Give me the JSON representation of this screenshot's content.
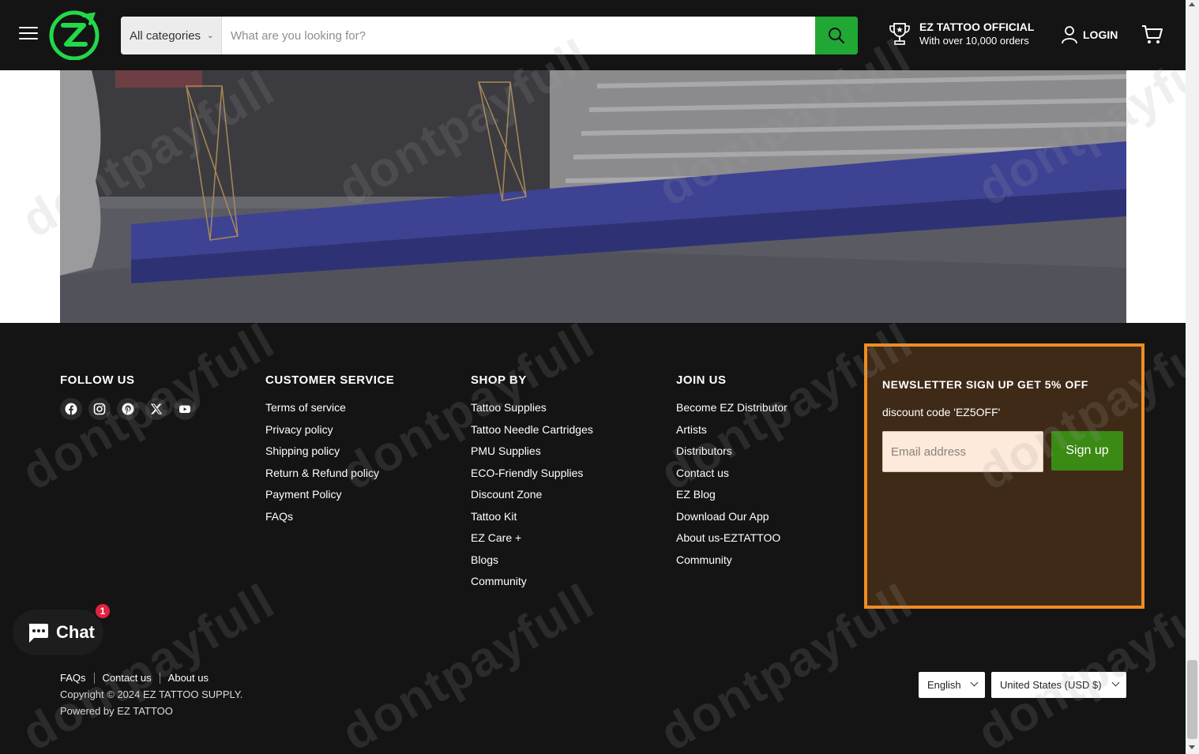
{
  "header": {
    "brand": "EZ",
    "search": {
      "category": "All categories",
      "placeholder": "What are you looking for?",
      "value": ""
    },
    "official": {
      "title": "EZ TATTOO OFFICIAL",
      "subtitle": "With over 10,000 orders"
    },
    "login_label": "LOGIN"
  },
  "footer": {
    "follow": {
      "title": "FOLLOW US",
      "icons": [
        "facebook-icon",
        "instagram-icon",
        "pinterest-icon",
        "x-icon",
        "youtube-icon"
      ]
    },
    "customer_service": {
      "title": "CUSTOMER SERVICE",
      "links": [
        "Terms of service",
        "Privacy policy",
        "Shipping policy",
        "Return & Refund policy",
        "Payment Policy",
        "FAQs"
      ]
    },
    "shop_by": {
      "title": "SHOP BY",
      "links": [
        "Tattoo Supplies",
        "Tattoo Needle Cartridges",
        "PMU Supplies",
        "ECO-Friendly Supplies",
        "Discount Zone",
        "Tattoo Kit",
        "EZ Care +",
        "Blogs",
        "Community"
      ]
    },
    "join_us": {
      "title": "JOIN US",
      "links": [
        "Become EZ Distributor",
        "Artists",
        "Distributors",
        "Contact us",
        "EZ Blog",
        "Download Our App",
        "About us-EZTATTOO",
        "Community"
      ]
    },
    "newsletter": {
      "title": "NEWSLETTER SIGN UP GET 5% OFF",
      "description": "discount code 'EZ5OFF'",
      "email_placeholder": "Email address",
      "button_label": "Sign up"
    },
    "bottom_links": [
      "FAQs",
      "Contact us",
      "About us"
    ],
    "copyright": "Copyright © 2024 EZ TATTOO SUPPLY.",
    "powered": "Powered by EZ TATTOO",
    "language": "English",
    "currency": "United States (USD $)"
  },
  "chat": {
    "label": "Chat",
    "badge": "1"
  },
  "watermark": "dontpayfull",
  "colors": {
    "background": "#141414",
    "accent_green": "#21a834",
    "newsletter_bg": "#3f2a17",
    "newsletter_border": "#f08c22",
    "signup_button": "#3a8a14",
    "badge_red": "#e3223f"
  }
}
